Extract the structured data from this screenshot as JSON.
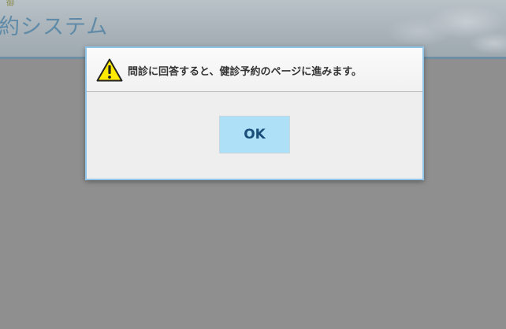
{
  "app": {
    "top_mark": "御",
    "title": "約システム"
  },
  "dialog": {
    "icon": "warning-icon",
    "message": "問診に回答すると、健診予約のページに進みます。",
    "ok_label": "OK"
  },
  "colors": {
    "overlay": "#8f8f8f",
    "dialog_border": "#8fc3e8",
    "ok_button_bg": "#aee0f8",
    "ok_button_text": "#1b4f7a",
    "title_text": "#5f8ba8",
    "warning_fill": "#ffeb00"
  }
}
